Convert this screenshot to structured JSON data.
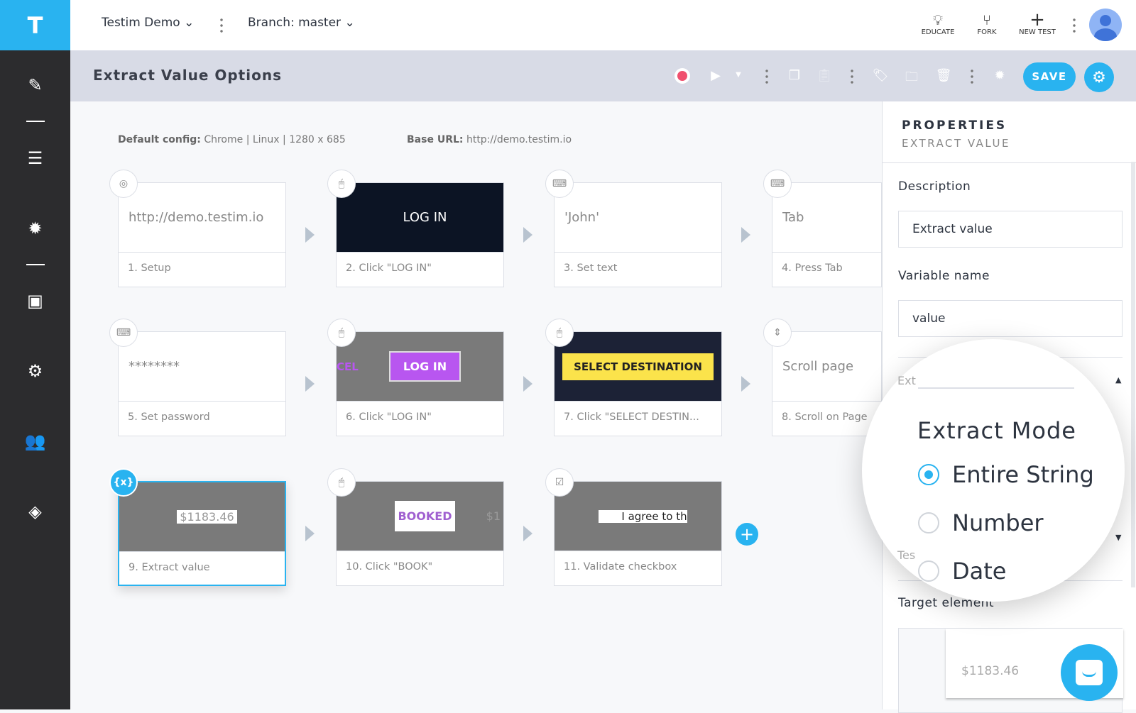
{
  "sidebar": {
    "logo": "T",
    "items": [
      "edit-icon",
      "list-icon",
      "bug-icon",
      "playlist-icon",
      "settings-icon",
      "users-icon",
      "mask-icon"
    ]
  },
  "topbar": {
    "project": "Testim Demo",
    "branch": "Branch: master",
    "educate": "EDUCATE",
    "fork": "FORK",
    "new_test": "NEW TEST"
  },
  "toolbar": {
    "title": "Extract Value Options",
    "save": "SAVE",
    "record_color": "#f0506e"
  },
  "meta": {
    "config_label": "Default config:",
    "config_value": "Chrome | Linux | 1280 x 685",
    "url_label": "Base URL:",
    "url_value": "http://demo.testim.io"
  },
  "steps": [
    {
      "icon": "chrome-icon",
      "preview": "http://demo.testim.io",
      "label": "1. Setup"
    },
    {
      "icon": "mouse-icon",
      "preview": "LOG IN",
      "label": "2. Click \"LOG IN\""
    },
    {
      "icon": "keyboard-icon",
      "preview": "'John'",
      "label": "3. Set text"
    },
    {
      "icon": "keyboard-icon",
      "preview": "Tab",
      "label": "4. Press Tab"
    },
    {
      "icon": "keyboard-icon",
      "preview": "********",
      "label": "5. Set password"
    },
    {
      "icon": "mouse-icon",
      "preview": "LOG IN",
      "preview_side": "CEL",
      "label": "6. Click \"LOG IN\""
    },
    {
      "icon": "mouse-icon",
      "preview": "SELECT DESTINATION",
      "label": "7. Click \"SELECT DESTIN..."
    },
    {
      "icon": "scroll-icon",
      "preview": "Scroll page",
      "label": "8. Scroll on Page"
    },
    {
      "icon": "variable-icon",
      "badge": "{x}",
      "preview": "$1183.46",
      "label": "9. Extract value"
    },
    {
      "icon": "mouse-icon",
      "preview": "BOOKED",
      "preview_side": "$1",
      "label": "10. Click \"BOOK\""
    },
    {
      "icon": "checkbox-icon",
      "preview": "I agree to th",
      "label": "11. Validate checkbox"
    }
  ],
  "panel": {
    "heading": "PROPERTIES",
    "subheading": "EXTRACT VALUE",
    "description_label": "Description",
    "description_value": "Extract value",
    "variable_label": "Variable name",
    "variable_value": "value",
    "extract_partial": "Ext",
    "test_partial": "Tes",
    "target_label": "Target element",
    "target_value": "$1183.46"
  },
  "extract_mode": {
    "title": "Extract Mode",
    "options": [
      {
        "label": "Entire String",
        "selected": true
      },
      {
        "label": "Number",
        "selected": false
      },
      {
        "label": "Date",
        "selected": false
      }
    ]
  },
  "colors": {
    "accent": "#29b3f0",
    "sidebar": "#2c2c2e",
    "toolbar": "#d8dbe6"
  }
}
